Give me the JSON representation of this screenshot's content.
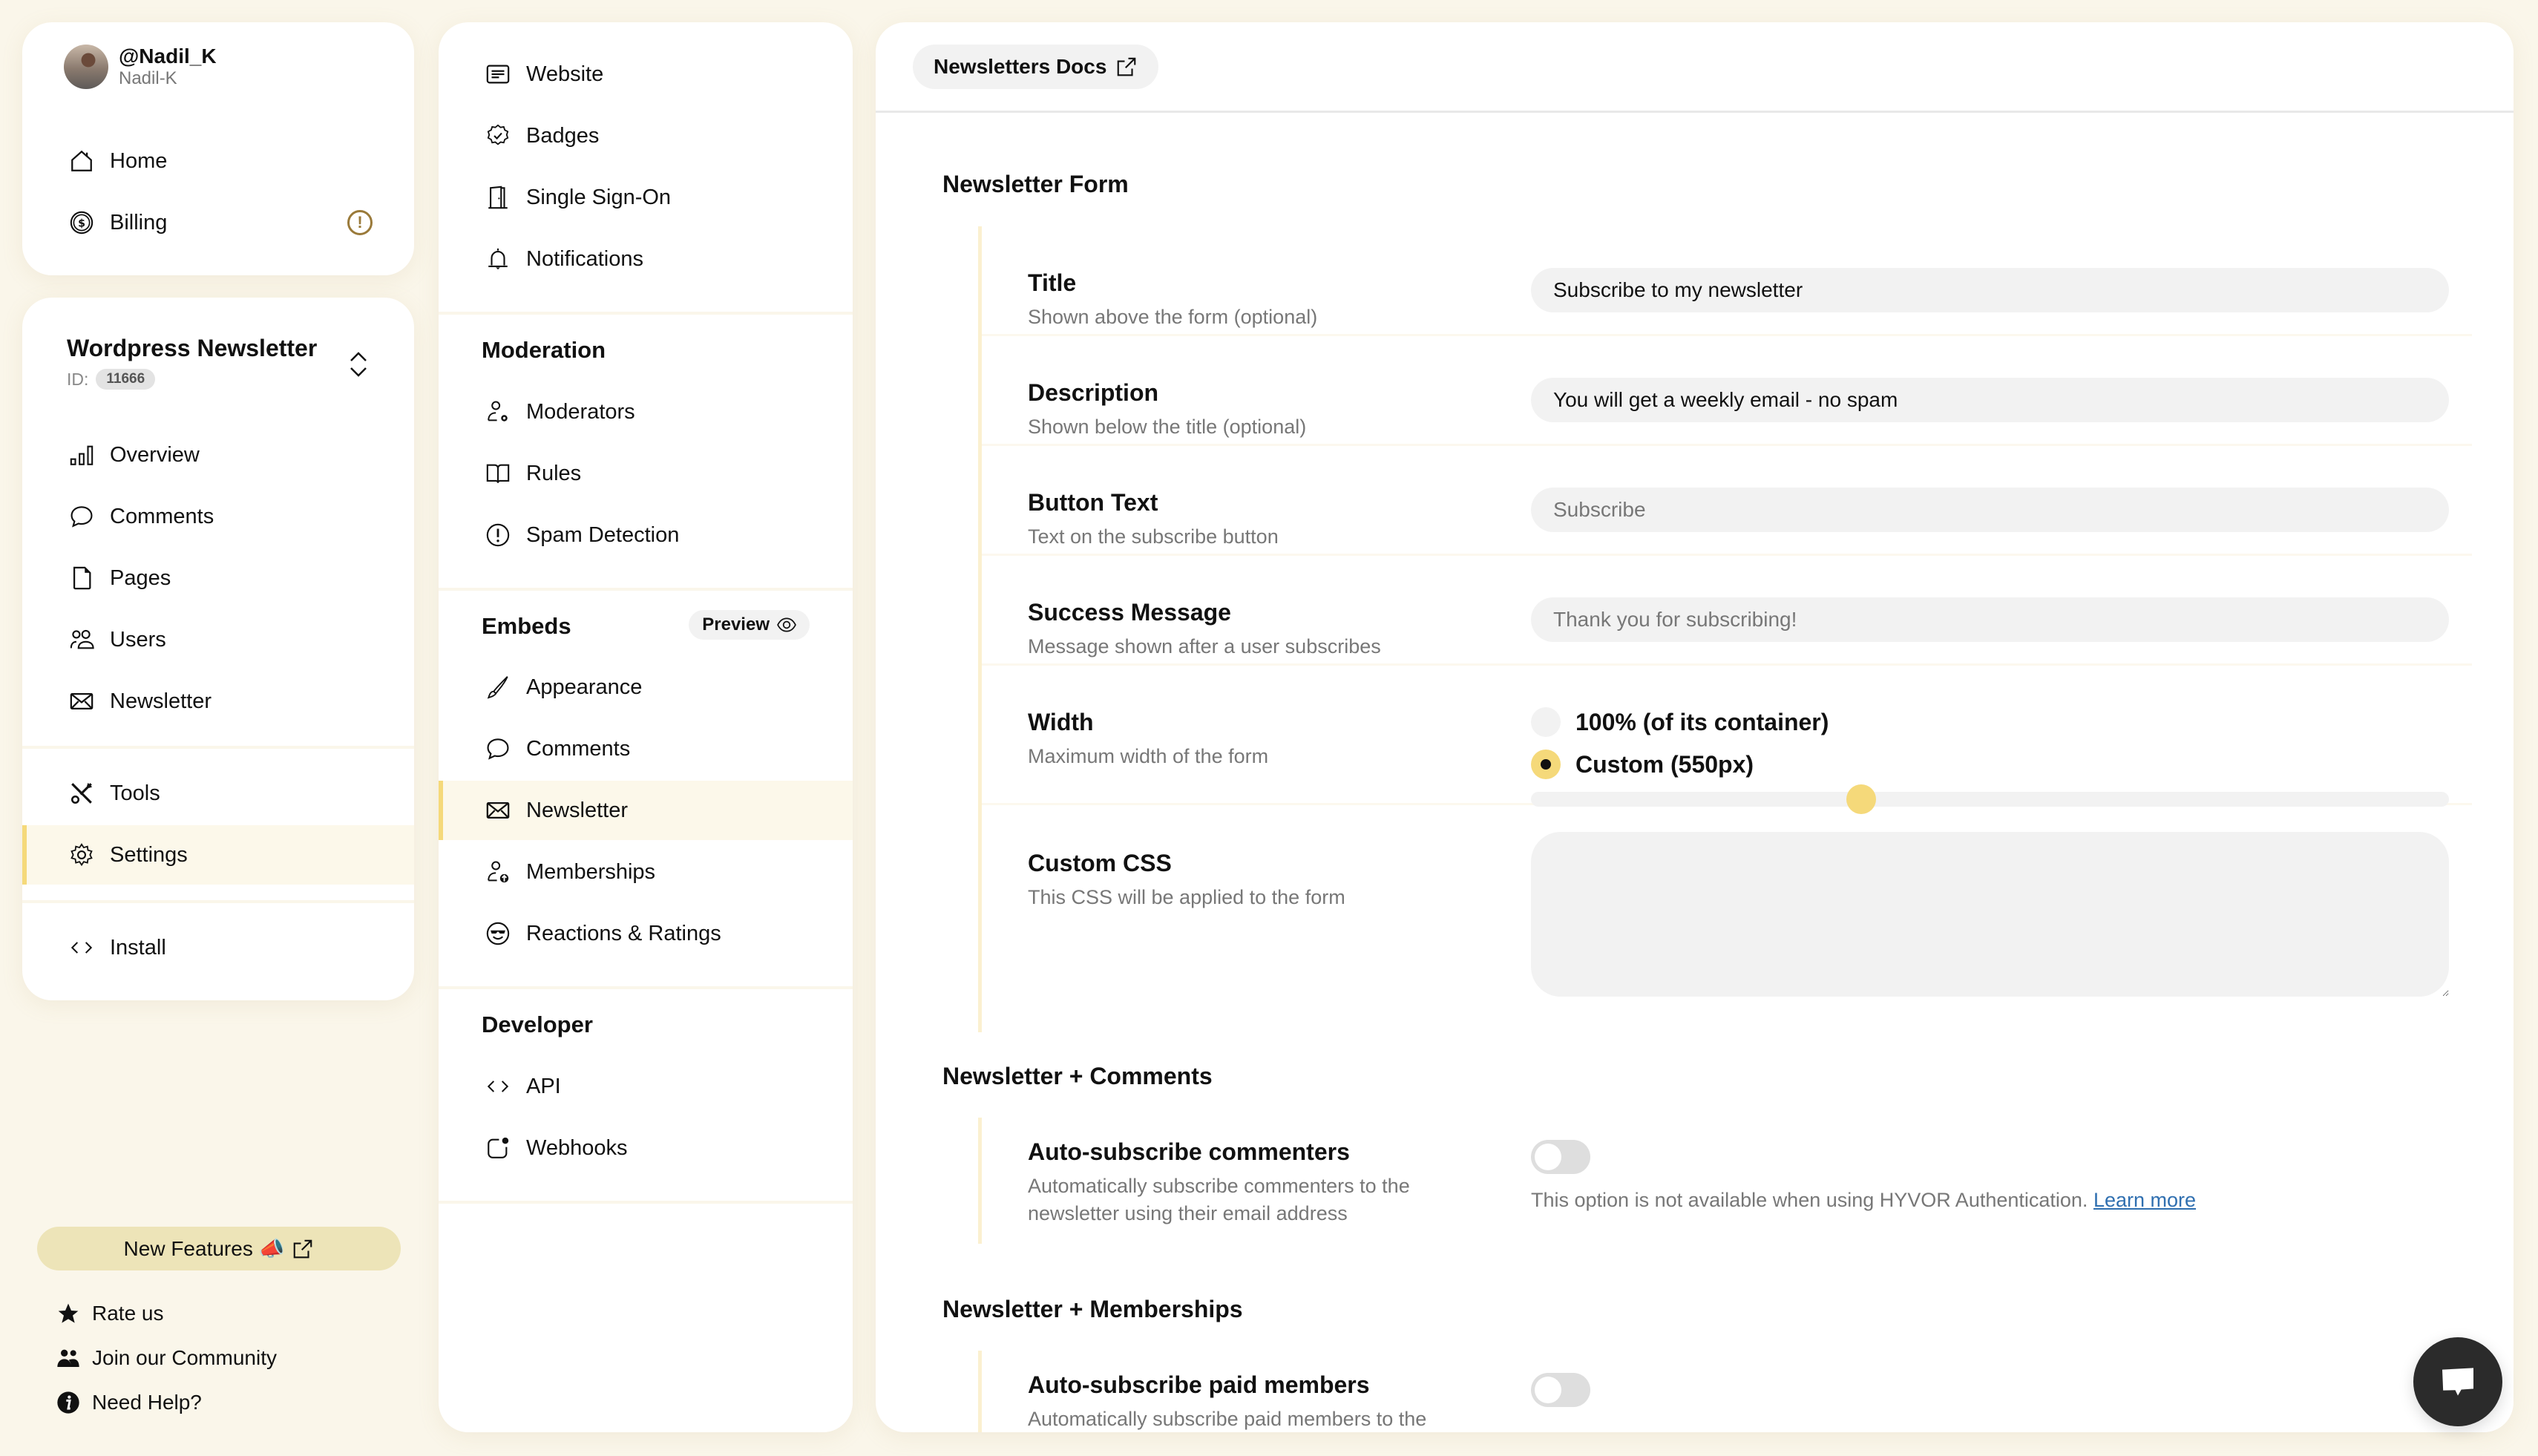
{
  "user": {
    "handle": "@Nadil_K",
    "username": "Nadil-K"
  },
  "account_nav": [
    {
      "label": "Home",
      "icon": "home-icon"
    },
    {
      "label": "Billing",
      "icon": "dollar-circle-icon",
      "alert": "!"
    }
  ],
  "site": {
    "name": "Wordpress Newsletter",
    "id_label": "ID:",
    "id": "11666"
  },
  "site_nav": [
    {
      "label": "Overview",
      "icon": "bar-chart-icon"
    },
    {
      "label": "Comments",
      "icon": "chat-bubble-icon"
    },
    {
      "label": "Pages",
      "icon": "file-icon"
    },
    {
      "label": "Users",
      "icon": "users-icon"
    },
    {
      "label": "Newsletter",
      "icon": "envelope-icon"
    },
    {
      "label": "Tools",
      "icon": "tools-icon"
    },
    {
      "label": "Settings",
      "icon": "gear-icon",
      "active": true
    },
    {
      "label": "Install",
      "icon": "code-icon"
    }
  ],
  "footer": {
    "new_features": "New Features 📣",
    "links": [
      {
        "label": "Rate us",
        "icon": "star-icon"
      },
      {
        "label": "Join our Community",
        "icon": "community-icon"
      },
      {
        "label": "Need Help?",
        "icon": "info-icon"
      }
    ]
  },
  "settings_nav": {
    "general": [
      {
        "label": "Website",
        "icon": "website-icon"
      },
      {
        "label": "Badges",
        "icon": "badge-check-icon"
      },
      {
        "label": "Single Sign-On",
        "icon": "door-icon"
      },
      {
        "label": "Notifications",
        "icon": "bell-icon"
      }
    ],
    "moderation_title": "Moderation",
    "moderation": [
      {
        "label": "Moderators",
        "icon": "user-gear-icon"
      },
      {
        "label": "Rules",
        "icon": "book-icon"
      },
      {
        "label": "Spam Detection",
        "icon": "exclamation-circle-icon"
      }
    ],
    "embeds_title": "Embeds",
    "preview_label": "Preview",
    "embeds": [
      {
        "label": "Appearance",
        "icon": "brush-icon"
      },
      {
        "label": "Comments",
        "icon": "chat-bubble-icon"
      },
      {
        "label": "Newsletter",
        "icon": "envelope-icon",
        "active": true
      },
      {
        "label": "Memberships",
        "icon": "user-up-icon"
      },
      {
        "label": "Reactions & Ratings",
        "icon": "emoji-sunglasses-icon"
      }
    ],
    "developer_title": "Developer",
    "developer": [
      {
        "label": "API",
        "icon": "code-icon"
      },
      {
        "label": "Webhooks",
        "icon": "webhook-icon"
      }
    ]
  },
  "main": {
    "docs_button": "Newsletters Docs",
    "form_section": {
      "title": "Newsletter Form",
      "fields": [
        {
          "label": "Title",
          "help": "Shown above the form (optional)",
          "value": "Subscribe to my newsletter",
          "placeholder": ""
        },
        {
          "label": "Description",
          "help": "Shown below the title (optional)",
          "value": "You will get a weekly email - no spam",
          "placeholder": ""
        },
        {
          "label": "Button Text",
          "help": "Text on the subscribe button",
          "value": "",
          "placeholder": "Subscribe"
        },
        {
          "label": "Success Message",
          "help": "Message shown after a user subscribes",
          "value": "",
          "placeholder": "Thank you for subscribing!"
        }
      ],
      "width": {
        "label": "Width",
        "help": "Maximum width of the form",
        "options": [
          "100% (of its container)",
          "Custom (550px)"
        ],
        "selected": 1,
        "slider_fraction": 0.36
      },
      "custom_css": {
        "label": "Custom CSS",
        "help": "This CSS will be applied to the form",
        "value": ""
      }
    },
    "comments_section": {
      "title": "Newsletter + Comments",
      "label": "Auto-subscribe commenters",
      "help": "Automatically subscribe commenters to the newsletter using their email address",
      "enabled": false,
      "note": "This option is not available when using HYVOR Authentication.",
      "note_link": "Learn more"
    },
    "memberships_section": {
      "title": "Newsletter + Memberships",
      "label": "Auto-subscribe paid members",
      "help": "Automatically subscribe paid members to the",
      "enabled": false
    }
  },
  "colors": {
    "accent": "#f5d97a",
    "background": "#faf6ea",
    "link": "#2f6fb0",
    "input_bg": "#f2f2f2"
  }
}
